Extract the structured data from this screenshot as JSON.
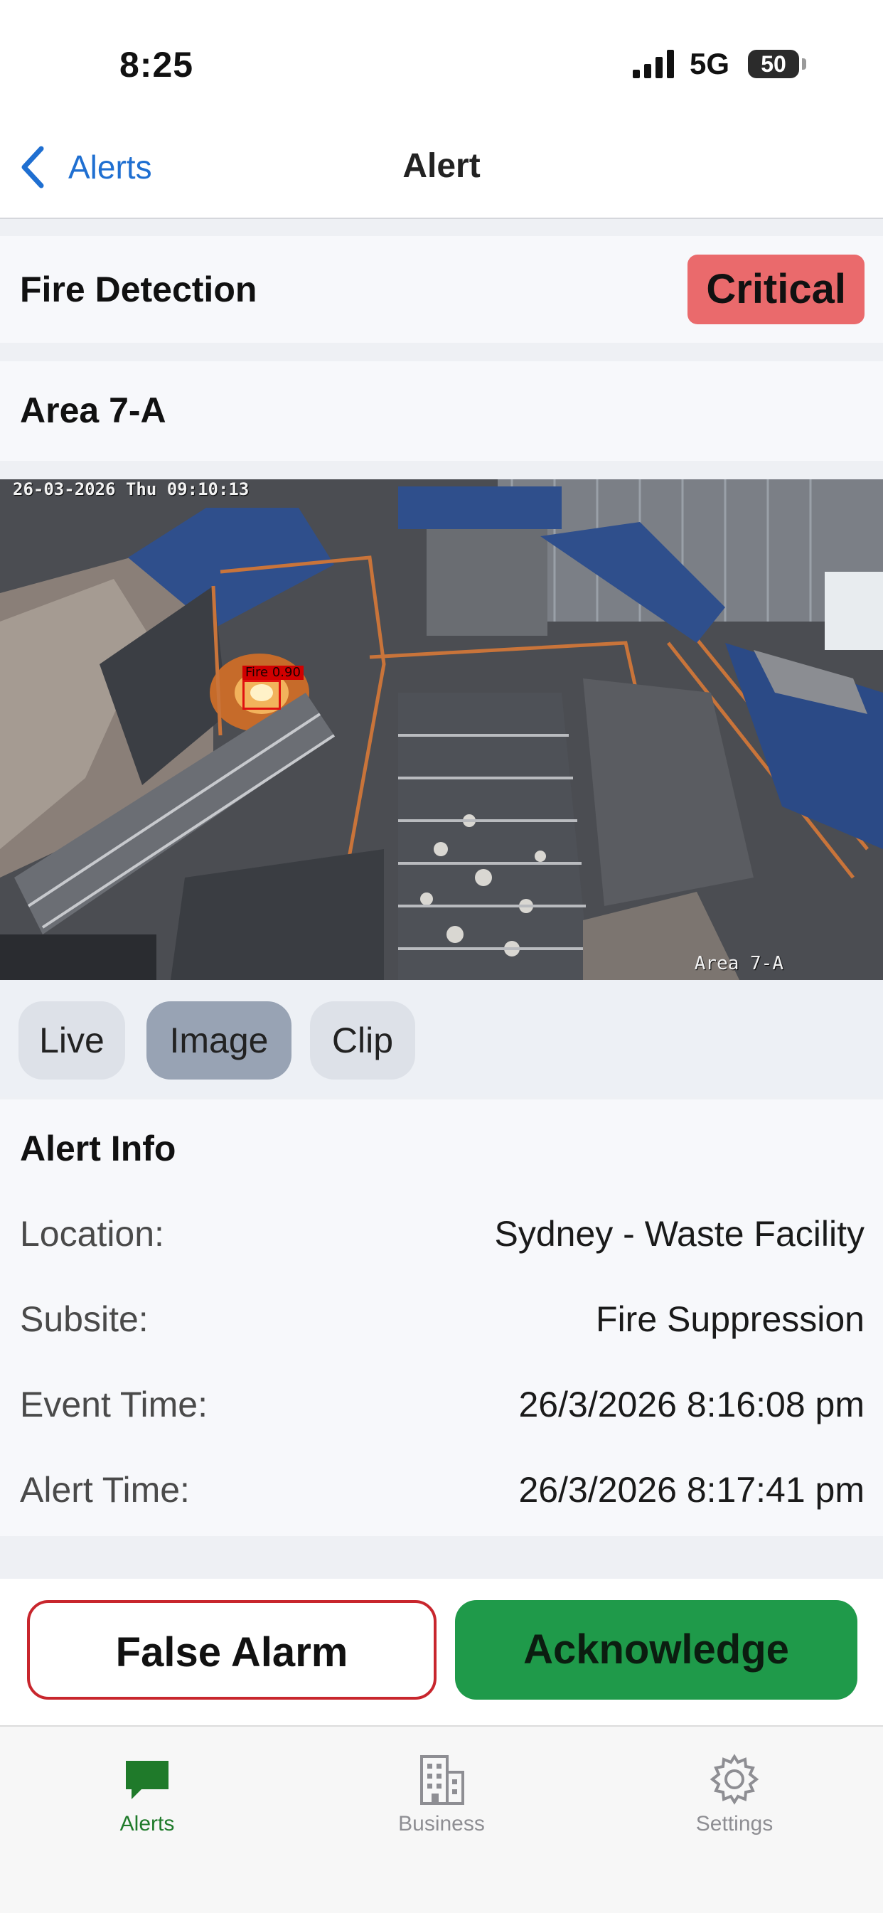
{
  "status_bar": {
    "time": "8:25",
    "network": "5G",
    "battery": "50"
  },
  "nav": {
    "back_label": "Alerts",
    "title": "Alert"
  },
  "alert": {
    "type": "Fire Detection",
    "severity": "Critical",
    "area": "Area 7-A"
  },
  "camera": {
    "timestamp": "26-03-2026 Thu 09:10:13",
    "area_label": "Area 7-A",
    "detection_label": "Fire 0.90"
  },
  "media_tabs": {
    "live": "Live",
    "image": "Image",
    "clip": "Clip",
    "selected": "Image"
  },
  "info": {
    "title": "Alert Info",
    "rows": [
      {
        "label": "Location:",
        "value": "Sydney - Waste Facility"
      },
      {
        "label": "Subsite:",
        "value": "Fire Suppression"
      },
      {
        "label": "Event Time:",
        "value": "26/3/2026 8:16:08 pm"
      },
      {
        "label": "Alert Time:",
        "value": "26/3/2026 8:17:41 pm"
      }
    ]
  },
  "actions": {
    "false_alarm": "False Alarm",
    "acknowledge": "Acknowledge"
  },
  "tabs": {
    "alerts": "Alerts",
    "business": "Business",
    "settings": "Settings",
    "active": "Alerts"
  },
  "colors": {
    "critical": "#ea6a6c",
    "acknowledge": "#1f9a4a",
    "false_alarm_border": "#c8262d",
    "link": "#1f6fd1",
    "active_tab": "#1f7a2a"
  },
  "icons": {
    "back": "chevron-left-icon",
    "alerts_tab": "chat-bubble-icon",
    "business_tab": "building-icon",
    "settings_tab": "gear-icon"
  }
}
